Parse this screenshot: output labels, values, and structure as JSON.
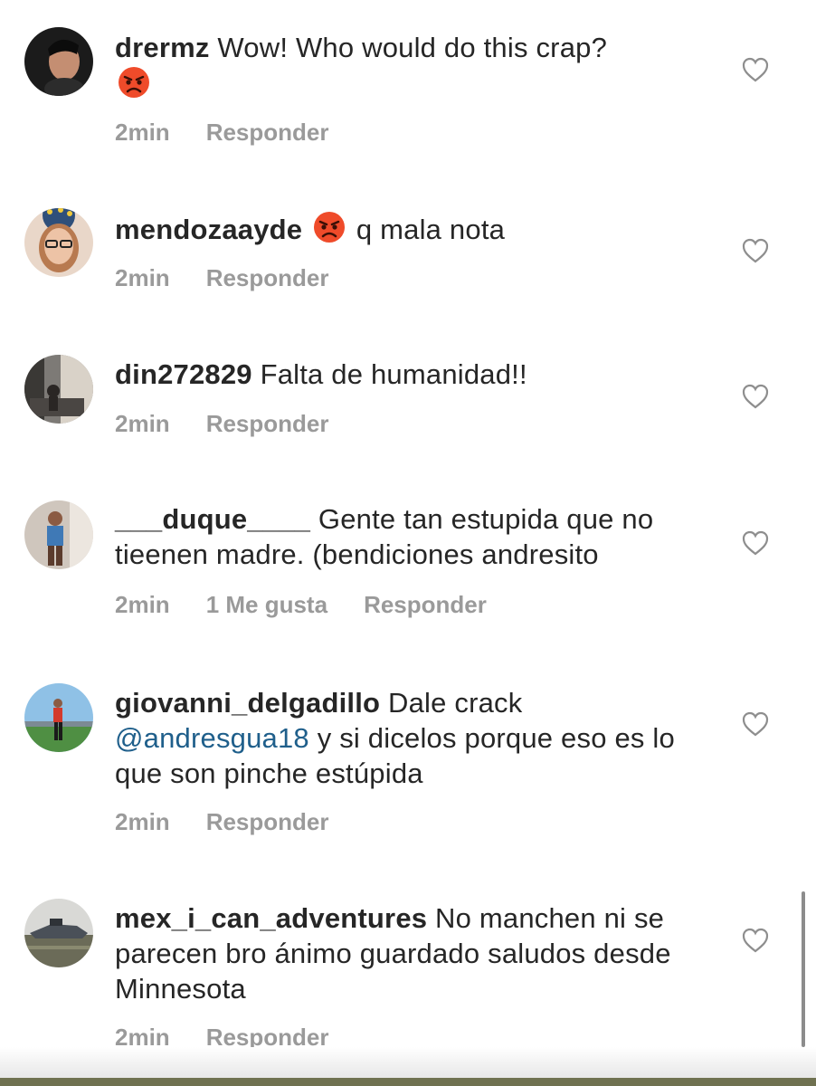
{
  "comments": [
    {
      "username": "drermz",
      "text_before": "Wow! Who would do this crap?",
      "emoji": "angry-face",
      "text_after": "",
      "time": "2min",
      "likes": "",
      "reply": "Responder"
    },
    {
      "username": "mendozaayde",
      "text_before": "",
      "emoji": "angry-face",
      "text_after": "q mala nota",
      "time": "2min",
      "likes": "",
      "reply": "Responder"
    },
    {
      "username": "din272829",
      "text_before": "Falta de humanidad!!",
      "time": "2min",
      "likes": "",
      "reply": "Responder"
    },
    {
      "username": "___duque____",
      "text_before": "Gente tan estupida que no tieenen madre. (bendiciones andresito",
      "time": "2min",
      "likes": "1 Me gusta",
      "reply": "Responder"
    },
    {
      "username": "giovanni_delgadillo",
      "text_before": "Dale crack",
      "mention": "@andresgua18",
      "text_after": "y si dicelos porque eso es lo que son pinche estúpida",
      "time": "2min",
      "likes": "",
      "reply": "Responder"
    },
    {
      "username": "mex_i_can_adventures",
      "text_before": "No manchen ni se parecen bro ánimo guardado saludos desde Minnesota",
      "time": "2min",
      "likes": "",
      "reply": "Responder"
    }
  ],
  "icons": {
    "like": "heart-outline-icon",
    "emoji": "angry-face-emoji"
  },
  "colors": {
    "text": "#262626",
    "meta": "#9a9a9a",
    "mention": "#1f5f8b",
    "heart": "#8e8e8e"
  }
}
